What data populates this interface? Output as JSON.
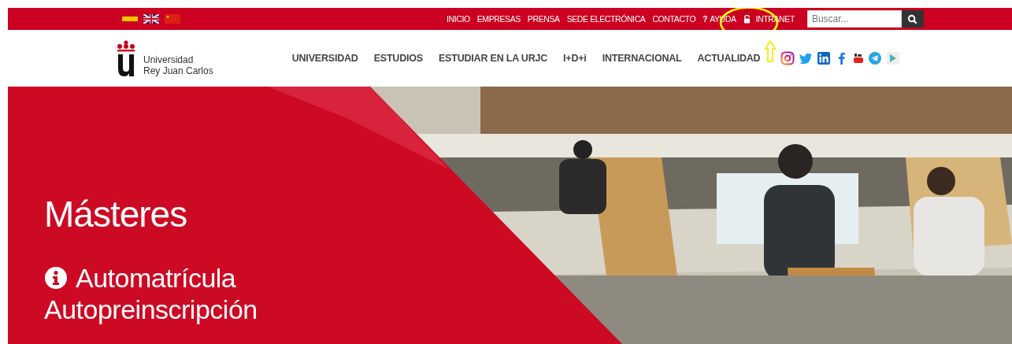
{
  "languages": [
    {
      "kind": "es",
      "selected": true
    },
    {
      "kind": "en",
      "selected": false
    },
    {
      "kind": "zh",
      "selected": false
    }
  ],
  "top_links": [
    {
      "kind": "link",
      "label": "INICIO"
    },
    {
      "kind": "link",
      "label": "EMPRESAS"
    },
    {
      "kind": "link",
      "label": "PRENSA"
    },
    {
      "kind": "link",
      "label": "SEDE ELECTRÓNICA"
    },
    {
      "kind": "link",
      "label": "CONTACTO"
    },
    {
      "kind": "help",
      "icon": "?",
      "label": "AYUDA"
    },
    {
      "kind": "lock",
      "label": "INTRANET"
    }
  ],
  "search": {
    "placeholder": "Buscar..."
  },
  "logo": {
    "line_1": "Universidad",
    "line_2": "Rey Juan Carlos"
  },
  "nav": [
    "UNIVERSIDAD",
    "ESTUDIOS",
    "ESTUDIAR EN LA URJC",
    "I+D+i",
    "INTERNACIONAL",
    "ACTUALIDAD"
  ],
  "social": [
    {
      "kind": "instagram"
    },
    {
      "kind": "twitter"
    },
    {
      "kind": "linkedin"
    },
    {
      "kind": "facebook"
    },
    {
      "kind": "youtube"
    },
    {
      "kind": "telegram"
    },
    {
      "kind": "play"
    }
  ],
  "hero": {
    "title": "Másteres",
    "lines": [
      "Automatrícula",
      "Autopreinscripción"
    ]
  }
}
